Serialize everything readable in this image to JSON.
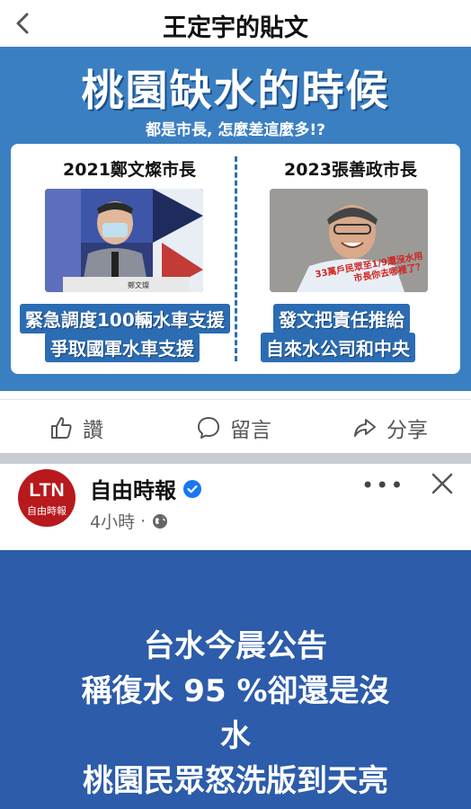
{
  "topbar": {
    "title": "王定宇的貼文"
  },
  "shared_image": {
    "headline": "桃園缺水的時候",
    "subtitle": "都是市長, 怎麼差這麼多!?",
    "left": {
      "heading": "2021鄭文燦市長",
      "name_plate": "鄭文燦",
      "caption_line1": "緊急調度100輛水車支援",
      "caption_line2": "爭取國軍水車支援"
    },
    "right": {
      "heading": "2023張善政市長",
      "photo_text_line1": "33萬戶民眾至1/9還沒水用",
      "photo_text_line2": "市長你去哪裡了？",
      "caption_line1": "發文把責任推給",
      "caption_line2": "自來水公司和中央"
    }
  },
  "actions": {
    "like": "讚",
    "comment": "留言",
    "share": "分享"
  },
  "post": {
    "avatar_text": "LTN",
    "avatar_subtext": "自由時報",
    "page_name": "自由時報",
    "time": "4小時",
    "image_lines": [
      "台水今晨公告",
      "稱復水 95 %卻還是沒",
      "水",
      "桃園民眾怒洗版到天亮"
    ]
  },
  "colors": {
    "image_blue": "#3b7fc3",
    "caption_blue": "#2b6cb3",
    "ltn_red": "#b8191c",
    "post_blue": "#2c5caa",
    "verified_blue": "#1877f2"
  }
}
